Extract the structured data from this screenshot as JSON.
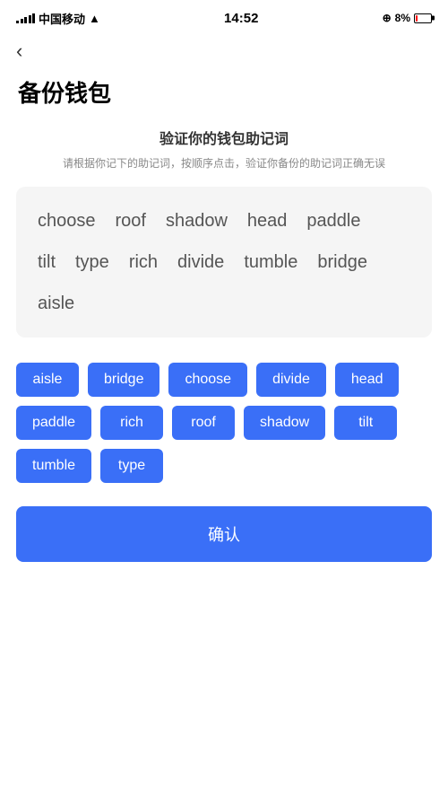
{
  "statusBar": {
    "carrier": "中国移动",
    "time": "14:52",
    "batteryPercent": "8%"
  },
  "backButton": "‹",
  "pageTitle": "备份钱包",
  "sectionTitle": "验证你的钱包助记词",
  "sectionDesc": "请根据你记下的助记词，按顺序点击，验证你备份的助记词正确无误",
  "displayWords": [
    "choose",
    "roof",
    "shadow",
    "head",
    "paddle",
    "tilt",
    "type",
    "rich",
    "divide",
    "tumble",
    "bridge",
    "aisle"
  ],
  "selectableWords": [
    "aisle",
    "bridge",
    "choose",
    "divide",
    "head",
    "paddle",
    "rich",
    "roof",
    "shadow",
    "tilt",
    "tumble",
    "type"
  ],
  "confirmLabel": "确认"
}
